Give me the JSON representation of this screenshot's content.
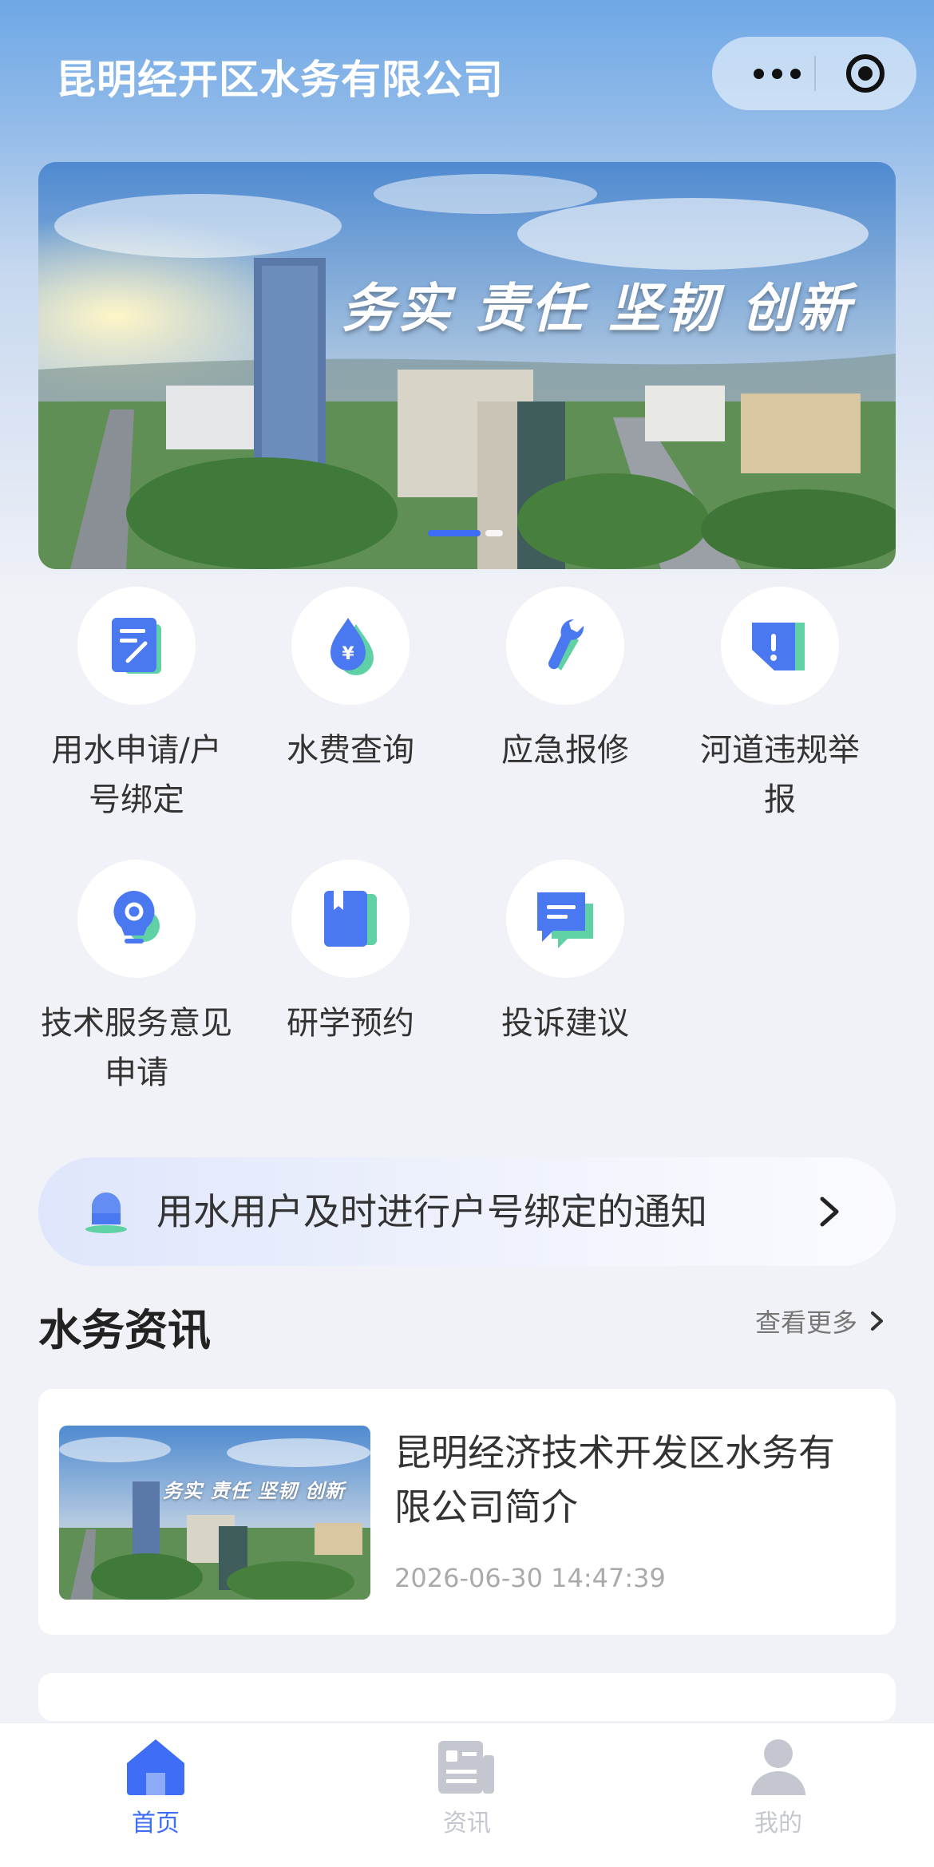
{
  "header": {
    "title": "昆明经开区水务有限公司",
    "menu_icon": "more-dots-icon",
    "close_icon": "target-circle-icon"
  },
  "banner": {
    "slogan": "务实 责任 坚韧 创新",
    "slides_total": 2,
    "active_slide": 1
  },
  "services": [
    {
      "label": "用水申请/户号绑定",
      "icon": "form-edit-icon"
    },
    {
      "label": "水费查询",
      "icon": "water-drop-yen-icon"
    },
    {
      "label": "应急报修",
      "icon": "wrench-icon"
    },
    {
      "label": "河道违规举报",
      "icon": "report-flag-icon"
    },
    {
      "label": "技术服务意见申请",
      "icon": "lightbulb-gear-icon"
    },
    {
      "label": "研学预约",
      "icon": "book-icon"
    },
    {
      "label": "投诉建议",
      "icon": "chat-bubble-icon"
    }
  ],
  "notice": {
    "text": "用水用户及时进行户号绑定的通知",
    "icon": "bell-icon"
  },
  "news": {
    "section_title": "水务资讯",
    "more_label": "查看更多",
    "items": [
      {
        "title": "昆明经济技术开发区水务有限公司简介",
        "time": "2026-06-30 14:47:39",
        "thumb_slogan": "务实 责任 坚韧 创新"
      }
    ]
  },
  "tabbar": {
    "items": [
      {
        "label": "首页",
        "icon": "home-icon",
        "active": true
      },
      {
        "label": "资讯",
        "icon": "news-icon",
        "active": false
      },
      {
        "label": "我的",
        "icon": "user-icon",
        "active": false
      }
    ]
  },
  "colors": {
    "accent": "#3d6ef5",
    "icon_green": "#5fd1a4",
    "tab_inactive": "#c4c7cf"
  }
}
